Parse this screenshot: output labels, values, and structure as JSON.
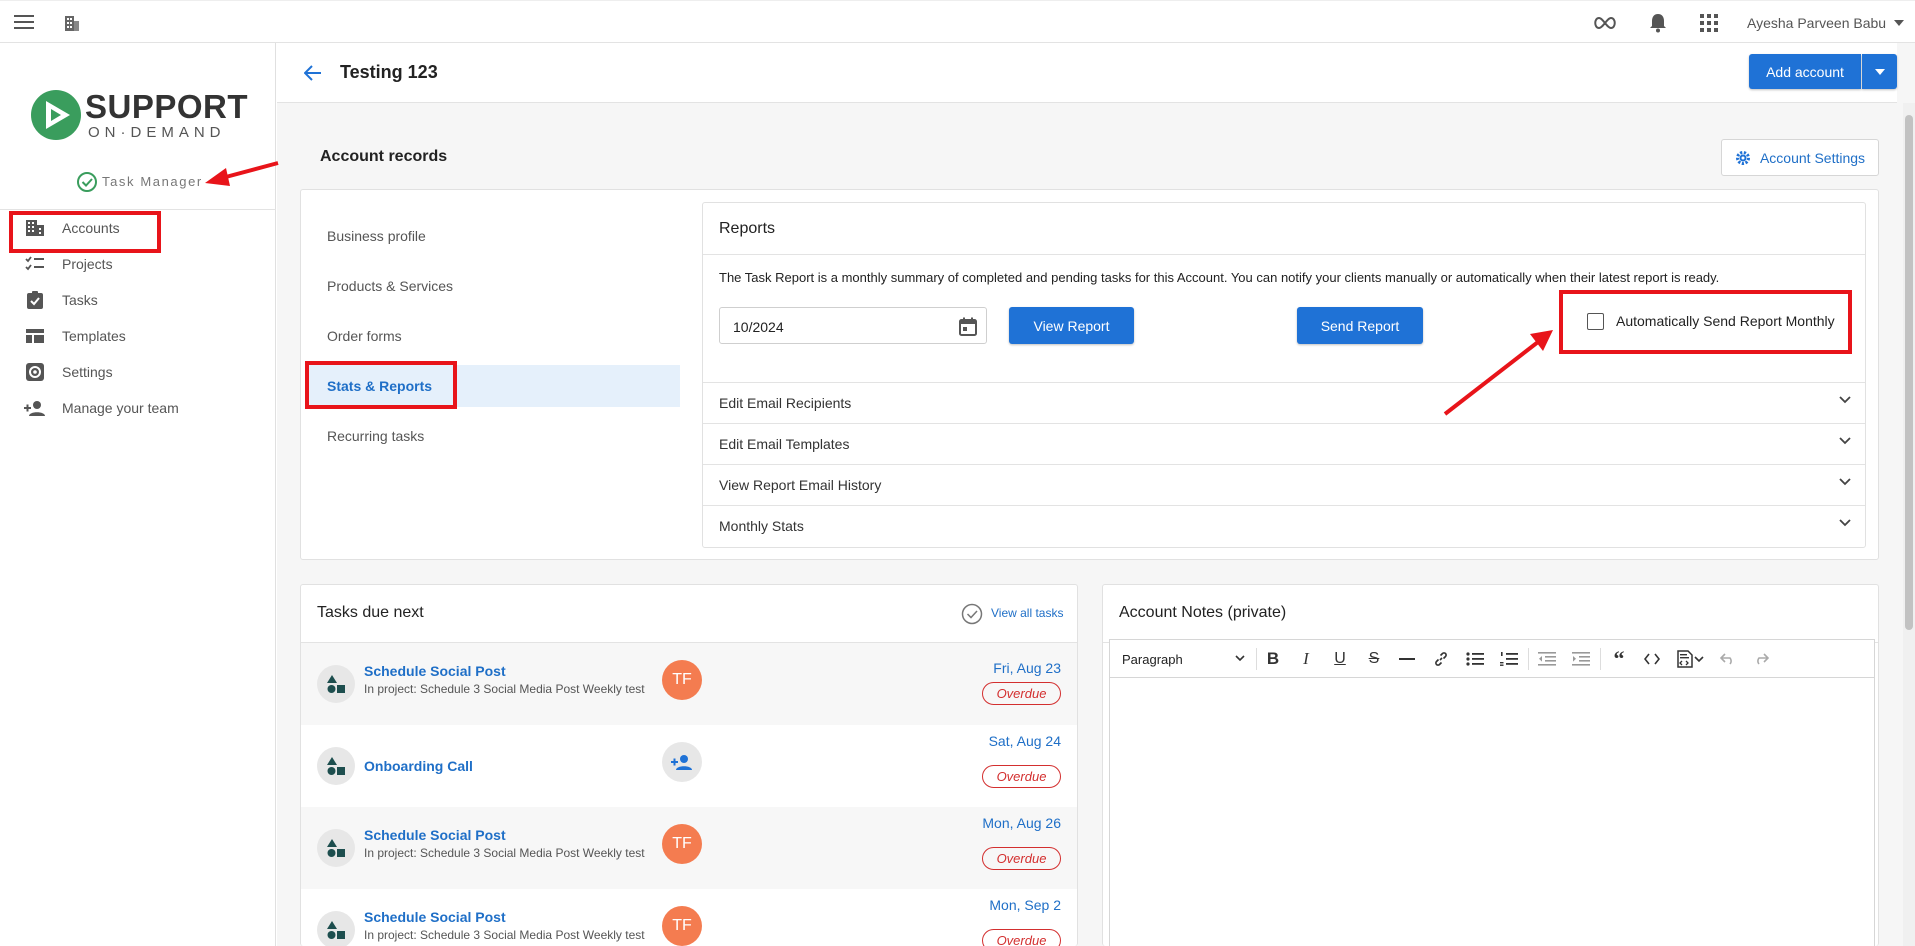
{
  "topbar": {
    "user_name": "Ayesha Parveen Babu"
  },
  "sidebar": {
    "logo": {
      "word1": "SUPPORT",
      "word2": "ON·DEMAND"
    },
    "module_label": "Task Manager",
    "items": [
      {
        "label": "Accounts",
        "icon": "building-icon"
      },
      {
        "label": "Projects",
        "icon": "checklist-icon"
      },
      {
        "label": "Tasks",
        "icon": "clipboard-check-icon"
      },
      {
        "label": "Templates",
        "icon": "table-icon"
      },
      {
        "label": "Settings",
        "icon": "gear-icon"
      },
      {
        "label": "Manage your team",
        "icon": "person-add-icon"
      }
    ]
  },
  "header": {
    "title": "Testing 123",
    "add_account_label": "Add account"
  },
  "section": {
    "title": "Account records",
    "settings_label": "Account Settings"
  },
  "subnav": {
    "items": [
      {
        "label": "Business profile"
      },
      {
        "label": "Products & Services"
      },
      {
        "label": "Order forms"
      },
      {
        "label": "Stats & Reports"
      },
      {
        "label": "Recurring tasks"
      }
    ],
    "active_index": 3
  },
  "reports": {
    "title": "Reports",
    "description": "The Task Report is a monthly summary of completed and pending tasks for this Account. You can notify your clients manually or automatically when their latest report is ready.",
    "date_value": "10/2024",
    "view_label": "View Report",
    "send_label": "Send Report",
    "auto_label": "Automatically Send Report Monthly",
    "auto_checked": false,
    "accordions": [
      {
        "label": "Edit Email Recipients"
      },
      {
        "label": "Edit Email Templates"
      },
      {
        "label": "View Report Email History"
      },
      {
        "label": "Monthly Stats"
      }
    ]
  },
  "tasks": {
    "title": "Tasks due next",
    "view_all_label": "View all tasks",
    "rows": [
      {
        "title": "Schedule Social Post",
        "project": "In project: Schedule 3 Social Media Post Weekly test",
        "assignee": "TF",
        "due": "Fri, Aug 23",
        "status": "Overdue"
      },
      {
        "title": "Onboarding Call",
        "project": "",
        "assignee": "",
        "due": "Sat, Aug 24",
        "status": "Overdue"
      },
      {
        "title": "Schedule Social Post",
        "project": "In project: Schedule 3 Social Media Post Weekly test",
        "assignee": "TF",
        "due": "Mon, Aug 26",
        "status": "Overdue"
      },
      {
        "title": "Schedule Social Post",
        "project": "In project: Schedule 3 Social Media Post Weekly test",
        "assignee": "TF",
        "due": "Mon, Sep 2",
        "status": "Overdue"
      }
    ]
  },
  "notes": {
    "title": "Account Notes (private)",
    "format_select": "Paragraph"
  },
  "colors": {
    "primary": "#1f72d6",
    "annotation_red": "#e8141a",
    "overdue": "#d32f2f",
    "avatar": "#f47c50",
    "brand_green": "#3a9d5d"
  }
}
